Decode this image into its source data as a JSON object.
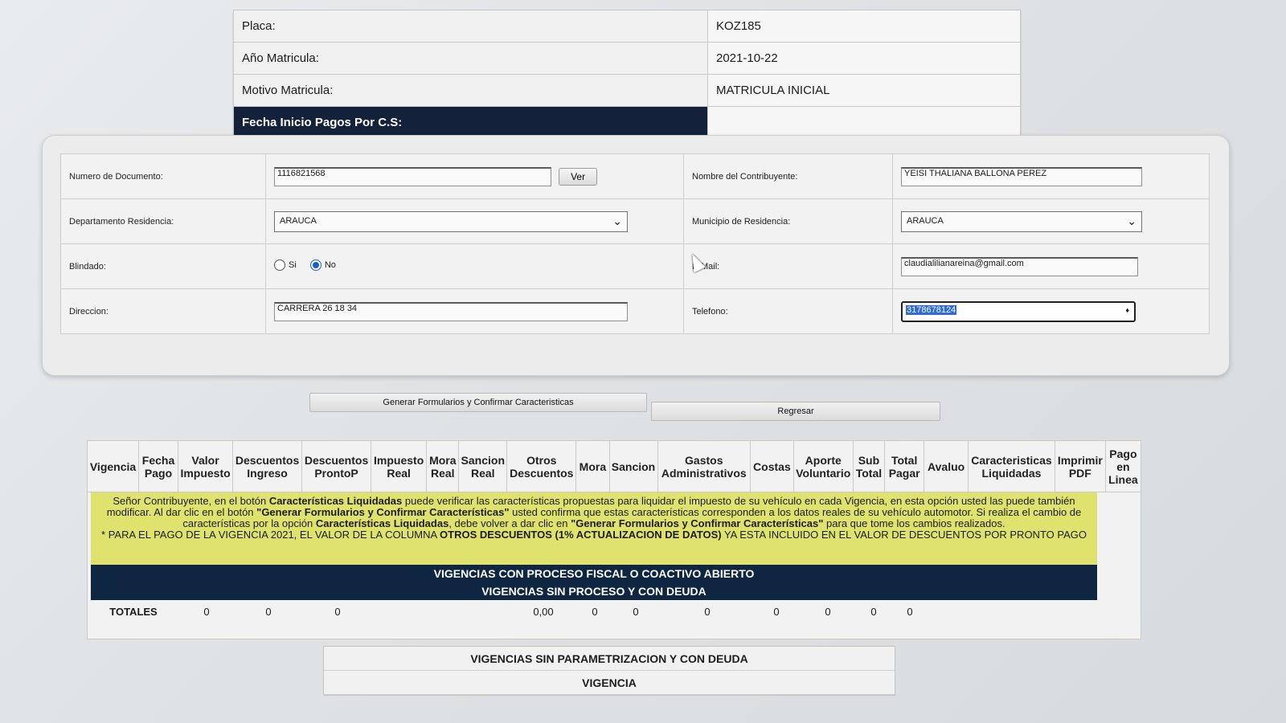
{
  "vehicle": {
    "rows": [
      {
        "label": "Placa:",
        "value": "KOZ185"
      },
      {
        "label": "Año Matricula:",
        "value": "2021-10-22"
      },
      {
        "label": "Motivo Matricula:",
        "value": "MATRICULA INICIAL"
      },
      {
        "label": "Fecha Inicio Pagos Por C.S:",
        "value": ""
      }
    ]
  },
  "form": {
    "doc_label": "Numero de Documento:",
    "doc_value": "1116821568",
    "ver_button": "Ver",
    "nombre_label": "Nombre del Contribuyente:",
    "nombre_value": "YEISI THALIANA BALLONA PEREZ",
    "depto_label": "Departamento Residencia:",
    "depto_value": "ARAUCA",
    "municipio_label": "Municipio de Residencia:",
    "municipio_value": "ARAUCA",
    "blindado_label": "Blindado:",
    "blindado_si": "Si",
    "blindado_no": "No",
    "blindado_selected": "No",
    "email_label": "E-Mail:",
    "email_value": "claudialilianareina@gmail.com",
    "direccion_label": "Direccion:",
    "direccion_value": "CARRERA 26  18  34",
    "telefono_label": "Telefono:",
    "telefono_value": "3178678124"
  },
  "actions": {
    "generar": "Generar Formularios y Confirmar Caracteristicas",
    "regresar": "Regresar"
  },
  "vigencias": {
    "columns": [
      "Vigencia",
      "Fecha Pago",
      "Valor Impuesto",
      "Descuentos Ingreso",
      "Descuentos ProntoP",
      "Impuesto Real",
      "Mora Real",
      "Sancion Real",
      "Otros Descuentos",
      "Mora",
      "Sancion",
      "Gastos Administrativos",
      "Costas",
      "Aporte Voluntario",
      "Sub Total",
      "Total Pagar",
      "Avaluo",
      "Caracteristicas Liquidadas",
      "Imprimir PDF",
      "Pago en Linea"
    ],
    "notice_p1_a": "Señor Contribuyente, en el botón ",
    "notice_p1_b": "Características Liquidadas",
    "notice_p1_c": " puede verificar las características propuestas para liquidar el impuesto de su vehículo en cada Vigencia, en esta opción usted las puede también modificar. Al dar clic en el botón ",
    "notice_p1_d": "\"Generar Formularios y Confirmar Características\"",
    "notice_p1_e": " usted confirma que estas características corresponden a los datos reales de su vehículo automotor. Si realiza el cambio de características por la opción ",
    "notice_p1_f": "Características Liquidadas",
    "notice_p1_g": ", debe volver a dar clic en ",
    "notice_p1_h": "\"Generar Formularios y Confirmar Características\"",
    "notice_p1_i": " para que tome los cambios realizados.",
    "notice_p2_a": "* PARA EL PAGO DE LA VIGENCIA 2021, EL VALOR DE LA COLUMNA ",
    "notice_p2_b": "OTROS DESCUENTOS (1% ACTUALIZACION DE DATOS)",
    "notice_p2_c": " YA ESTA INCLUIDO EN EL VALOR DE DESCUENTOS POR PRONTO PAGO",
    "band_fiscal": "VIGENCIAS CON PROCESO FISCAL O COACTIVO ABIERTO",
    "band_deuda": "VIGENCIAS SIN PROCESO Y CON DEUDA",
    "totals_label": "TOTALES",
    "totals": [
      "0",
      "0",
      "0",
      "",
      "",
      "",
      "0,00",
      "0",
      "0",
      "0",
      "0",
      "0",
      "0",
      "0"
    ]
  },
  "sin_param": {
    "title": "VIGENCIAS SIN PARAMETRIZACION Y CON DEUDA",
    "subtitle": "VIGENCIA"
  }
}
